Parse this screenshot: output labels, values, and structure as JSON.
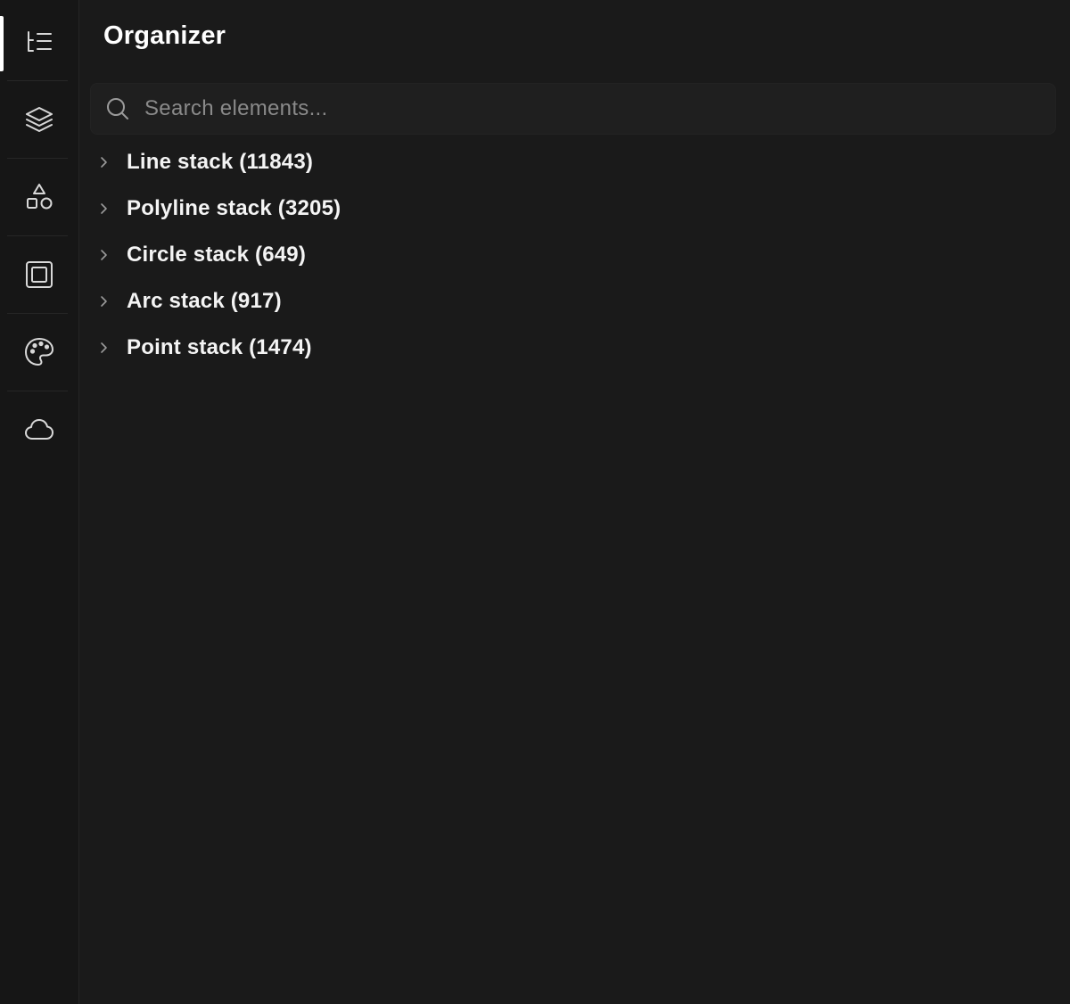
{
  "rail": {
    "items": [
      {
        "icon": "outline-list-icon",
        "active": true
      },
      {
        "icon": "layers-icon",
        "active": false
      },
      {
        "icon": "shapes-icon",
        "active": false
      },
      {
        "icon": "frame-icon",
        "active": false
      },
      {
        "icon": "palette-icon",
        "active": false
      },
      {
        "icon": "cloud-icon",
        "active": false
      }
    ]
  },
  "panel": {
    "title": "Organizer",
    "search": {
      "placeholder": "Search elements...",
      "value": ""
    },
    "tree": [
      {
        "label": "Line stack (11843)",
        "icon": "chevron-right-icon"
      },
      {
        "label": "Polyline stack (3205)",
        "icon": "chevron-right-icon"
      },
      {
        "label": "Circle stack (649)",
        "icon": "chevron-right-icon"
      },
      {
        "label": "Arc stack (917)",
        "icon": "chevron-right-icon"
      },
      {
        "label": "Point stack (1474)",
        "icon": "chevron-right-icon"
      }
    ]
  },
  "colors": {
    "background": "#1a1a1a",
    "rail": "#161616",
    "text": "#ffffff",
    "placeholder": "#8a8a8a",
    "icon": "#d6d6d6"
  }
}
